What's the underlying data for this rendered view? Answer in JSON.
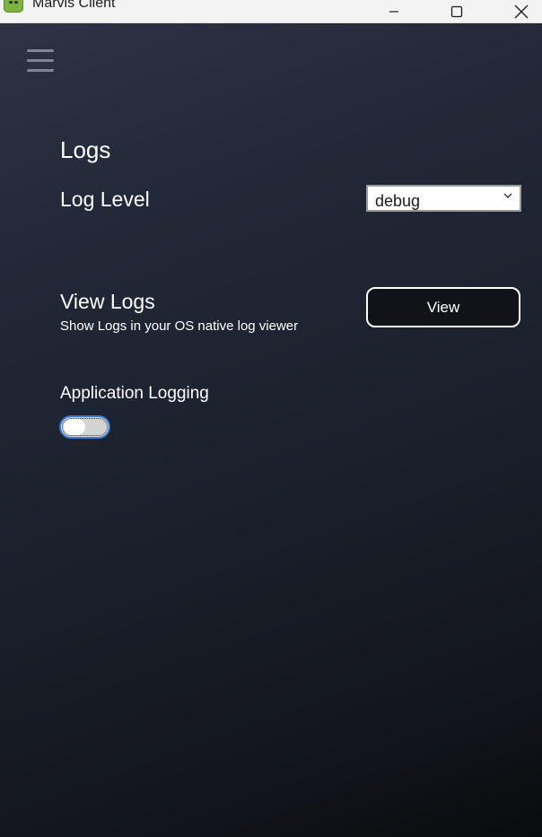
{
  "window": {
    "title": "Marvis Client",
    "controls": {
      "minimize_icon": "minimize-icon",
      "maximize_icon": "maximize-icon",
      "close_icon": "close-icon"
    }
  },
  "nav": {
    "menu_icon": "hamburger-menu-icon"
  },
  "logs": {
    "section_title": "Logs",
    "log_level": {
      "label": "Log Level",
      "selected": "debug"
    },
    "view_logs": {
      "label": "View Logs",
      "description": "Show Logs in your OS native log viewer",
      "button_label": "View"
    },
    "app_logging": {
      "label": "Application Logging",
      "enabled": false
    }
  },
  "colors": {
    "toggle_focus_border": "#3a7bd5",
    "background_top": "#2c3445",
    "background_bottom": "#0a0b0e",
    "app_icon": "#7cb342"
  }
}
